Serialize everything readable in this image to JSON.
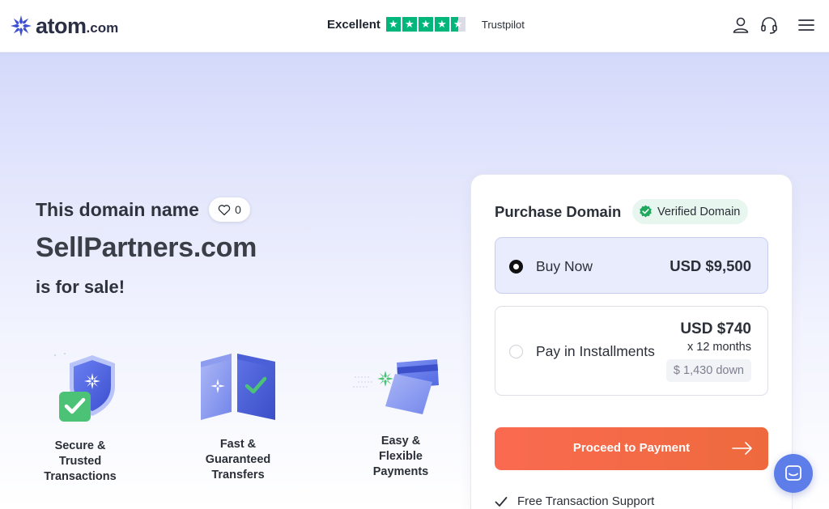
{
  "header": {
    "logo": {
      "brand": "atom",
      "tld": ".com"
    },
    "trustpilot": {
      "rating_label": "Excellent",
      "stars": 4.5,
      "name": "Trustpilot"
    },
    "icons": [
      "user-icon",
      "headset-icon",
      "menu-icon"
    ]
  },
  "hero": {
    "title": "This domain name",
    "likes": "0",
    "domain": "SellPartners.com",
    "subtitle": "is for sale!"
  },
  "features": [
    {
      "label": "Secure & Trusted Transactions",
      "lines": [
        "Secure &",
        "Trusted",
        "Transactions"
      ],
      "icon": "shield-check-icon"
    },
    {
      "label": "Fast & Guaranteed Transfers",
      "lines": [
        "Fast &",
        "Guaranteed",
        "Transfers"
      ],
      "icon": "transfer-icon"
    },
    {
      "label": "Easy & Flexible Payments",
      "lines": [
        "Easy &",
        "Flexible",
        "Payments"
      ],
      "icon": "cards-icon"
    }
  ],
  "purchase": {
    "title": "Purchase Domain",
    "verified_label": "Verified Domain",
    "options": [
      {
        "label": "Buy Now",
        "price": "USD $9,500",
        "selected": true
      },
      {
        "label": "Pay in Installments",
        "price": "USD $740",
        "term": "x 12 months",
        "down": "$ 1,430 down",
        "selected": false
      }
    ],
    "cta": "Proceed to Payment",
    "support": "Free Transaction Support"
  },
  "colors": {
    "accent": "#f46a4a",
    "brand": "#3e4fd4",
    "trustpilot": "#00b67a",
    "verified": "#1eaa5e",
    "chat": "#5d7ee8"
  }
}
